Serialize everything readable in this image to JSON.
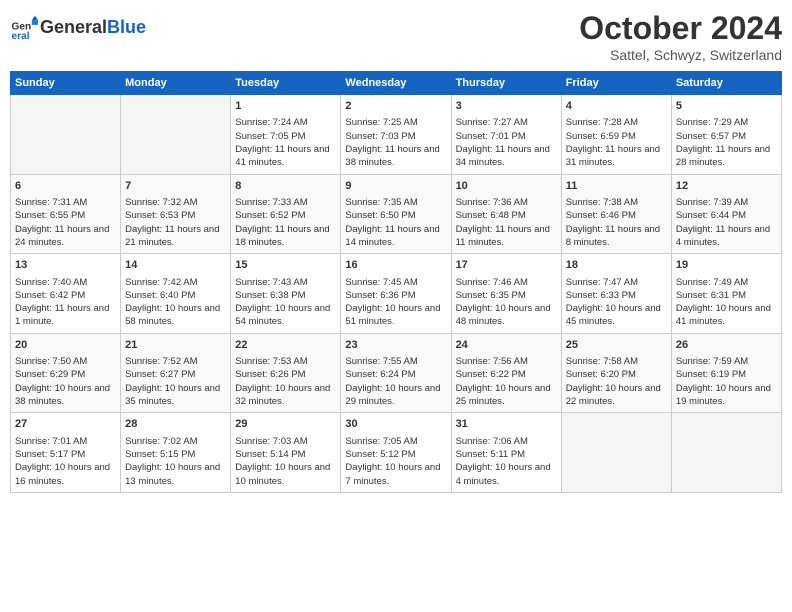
{
  "header": {
    "logo_general": "General",
    "logo_blue": "Blue",
    "month_title": "October 2024",
    "location": "Sattel, Schwyz, Switzerland"
  },
  "days_of_week": [
    "Sunday",
    "Monday",
    "Tuesday",
    "Wednesday",
    "Thursday",
    "Friday",
    "Saturday"
  ],
  "weeks": [
    [
      {
        "day": "",
        "info": ""
      },
      {
        "day": "",
        "info": ""
      },
      {
        "day": "1",
        "info": "Sunrise: 7:24 AM\nSunset: 7:05 PM\nDaylight: 11 hours and 41 minutes."
      },
      {
        "day": "2",
        "info": "Sunrise: 7:25 AM\nSunset: 7:03 PM\nDaylight: 11 hours and 38 minutes."
      },
      {
        "day": "3",
        "info": "Sunrise: 7:27 AM\nSunset: 7:01 PM\nDaylight: 11 hours and 34 minutes."
      },
      {
        "day": "4",
        "info": "Sunrise: 7:28 AM\nSunset: 6:59 PM\nDaylight: 11 hours and 31 minutes."
      },
      {
        "day": "5",
        "info": "Sunrise: 7:29 AM\nSunset: 6:57 PM\nDaylight: 11 hours and 28 minutes."
      }
    ],
    [
      {
        "day": "6",
        "info": "Sunrise: 7:31 AM\nSunset: 6:55 PM\nDaylight: 11 hours and 24 minutes."
      },
      {
        "day": "7",
        "info": "Sunrise: 7:32 AM\nSunset: 6:53 PM\nDaylight: 11 hours and 21 minutes."
      },
      {
        "day": "8",
        "info": "Sunrise: 7:33 AM\nSunset: 6:52 PM\nDaylight: 11 hours and 18 minutes."
      },
      {
        "day": "9",
        "info": "Sunrise: 7:35 AM\nSunset: 6:50 PM\nDaylight: 11 hours and 14 minutes."
      },
      {
        "day": "10",
        "info": "Sunrise: 7:36 AM\nSunset: 6:48 PM\nDaylight: 11 hours and 11 minutes."
      },
      {
        "day": "11",
        "info": "Sunrise: 7:38 AM\nSunset: 6:46 PM\nDaylight: 11 hours and 8 minutes."
      },
      {
        "day": "12",
        "info": "Sunrise: 7:39 AM\nSunset: 6:44 PM\nDaylight: 11 hours and 4 minutes."
      }
    ],
    [
      {
        "day": "13",
        "info": "Sunrise: 7:40 AM\nSunset: 6:42 PM\nDaylight: 11 hours and 1 minute."
      },
      {
        "day": "14",
        "info": "Sunrise: 7:42 AM\nSunset: 6:40 PM\nDaylight: 10 hours and 58 minutes."
      },
      {
        "day": "15",
        "info": "Sunrise: 7:43 AM\nSunset: 6:38 PM\nDaylight: 10 hours and 54 minutes."
      },
      {
        "day": "16",
        "info": "Sunrise: 7:45 AM\nSunset: 6:36 PM\nDaylight: 10 hours and 51 minutes."
      },
      {
        "day": "17",
        "info": "Sunrise: 7:46 AM\nSunset: 6:35 PM\nDaylight: 10 hours and 48 minutes."
      },
      {
        "day": "18",
        "info": "Sunrise: 7:47 AM\nSunset: 6:33 PM\nDaylight: 10 hours and 45 minutes."
      },
      {
        "day": "19",
        "info": "Sunrise: 7:49 AM\nSunset: 6:31 PM\nDaylight: 10 hours and 41 minutes."
      }
    ],
    [
      {
        "day": "20",
        "info": "Sunrise: 7:50 AM\nSunset: 6:29 PM\nDaylight: 10 hours and 38 minutes."
      },
      {
        "day": "21",
        "info": "Sunrise: 7:52 AM\nSunset: 6:27 PM\nDaylight: 10 hours and 35 minutes."
      },
      {
        "day": "22",
        "info": "Sunrise: 7:53 AM\nSunset: 6:26 PM\nDaylight: 10 hours and 32 minutes."
      },
      {
        "day": "23",
        "info": "Sunrise: 7:55 AM\nSunset: 6:24 PM\nDaylight: 10 hours and 29 minutes."
      },
      {
        "day": "24",
        "info": "Sunrise: 7:56 AM\nSunset: 6:22 PM\nDaylight: 10 hours and 25 minutes."
      },
      {
        "day": "25",
        "info": "Sunrise: 7:58 AM\nSunset: 6:20 PM\nDaylight: 10 hours and 22 minutes."
      },
      {
        "day": "26",
        "info": "Sunrise: 7:59 AM\nSunset: 6:19 PM\nDaylight: 10 hours and 19 minutes."
      }
    ],
    [
      {
        "day": "27",
        "info": "Sunrise: 7:01 AM\nSunset: 5:17 PM\nDaylight: 10 hours and 16 minutes."
      },
      {
        "day": "28",
        "info": "Sunrise: 7:02 AM\nSunset: 5:15 PM\nDaylight: 10 hours and 13 minutes."
      },
      {
        "day": "29",
        "info": "Sunrise: 7:03 AM\nSunset: 5:14 PM\nDaylight: 10 hours and 10 minutes."
      },
      {
        "day": "30",
        "info": "Sunrise: 7:05 AM\nSunset: 5:12 PM\nDaylight: 10 hours and 7 minutes."
      },
      {
        "day": "31",
        "info": "Sunrise: 7:06 AM\nSunset: 5:11 PM\nDaylight: 10 hours and 4 minutes."
      },
      {
        "day": "",
        "info": ""
      },
      {
        "day": "",
        "info": ""
      }
    ]
  ]
}
